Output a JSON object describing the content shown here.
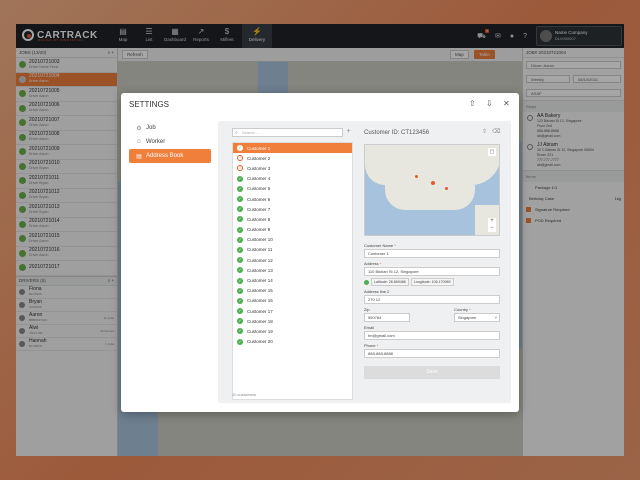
{
  "topbar": {
    "logo_text": "CARTRACK",
    "logo_sub": "DRIVEN BY INNOVATION",
    "nav": [
      {
        "label": "Map",
        "icon": "map-icon"
      },
      {
        "label": "List",
        "icon": "list-icon"
      },
      {
        "label": "Dashboard",
        "icon": "dashboard-icon"
      },
      {
        "label": "Reports",
        "icon": "reports-icon"
      },
      {
        "label": "Mifleet",
        "icon": "dollar-icon"
      },
      {
        "label": "Delivery",
        "icon": "bolt-icon"
      }
    ],
    "notification_count": "9",
    "company_name": "Name Company",
    "company_user": "DLV000007"
  },
  "sidebar": {
    "jobs_header": "JOBS (13/20)",
    "jobs": [
      {
        "id": "20210721003",
        "driver": "Driver Name Fiona",
        "state": "done"
      },
      {
        "id": "20210721004",
        "driver": "Driver Aaron",
        "state": "active"
      },
      {
        "id": "20210721005",
        "driver": "Driver Aaron",
        "state": "done"
      },
      {
        "id": "20210721006",
        "driver": "Driver Aaron",
        "state": "done"
      },
      {
        "id": "20210721007",
        "driver": "Driver Aaron",
        "state": "done"
      },
      {
        "id": "20210721008",
        "driver": "Driver Aaron",
        "state": "done"
      },
      {
        "id": "20210721009",
        "driver": "Driver Aaron",
        "state": "done"
      },
      {
        "id": "20210721010",
        "driver": "Driver Bryan",
        "state": "done"
      },
      {
        "id": "20210721011",
        "driver": "Driver Bryan",
        "state": "done"
      },
      {
        "id": "20210721012",
        "driver": "Driver Bryan",
        "state": "done"
      },
      {
        "id": "20210721013",
        "driver": "Driver Bryan",
        "state": "done"
      },
      {
        "id": "20210721014",
        "driver": "Driver Aaron",
        "state": "done"
      },
      {
        "id": "20210721015",
        "driver": "Driver Aaron",
        "state": "done"
      },
      {
        "id": "20210721016",
        "driver": "Driver Aaron",
        "state": "done"
      },
      {
        "id": "20210721017",
        "driver": "",
        "state": "done"
      }
    ],
    "drivers_header": "DRIVERS (5)",
    "drivers": [
      {
        "name": "Fiona",
        "code": "BLN5936",
        "right": ""
      },
      {
        "name": "Bryan",
        "code": "JDN5436",
        "right": ""
      },
      {
        "name": "Aaron",
        "code": "BBB0037300",
        "right": "11 Jobs"
      },
      {
        "name": "Alwi",
        "code": "JWG7189",
        "right": "25 Routes"
      },
      {
        "name": "Hannah",
        "code": "BLN5936",
        "right": "1 Jobs"
      }
    ]
  },
  "map_toolbar": {
    "refresh": "Refresh",
    "map": "Map",
    "table": "Table"
  },
  "right_panel": {
    "header": "JOB# 20210721004",
    "driver_select": "Driver: Aaron",
    "freq_select": "Weekly",
    "date_select": "08/10/2021",
    "time_select": "ASAP",
    "stops_label": "Stops",
    "stops": [
      {
        "name": "AA Bakery",
        "lines": [
          "123 Bishan St 12, Singapore",
          "Floor 2nd",
          "888-888-8888",
          "ab@gmail.com"
        ]
      },
      {
        "name": "JJ Abram",
        "lines": [
          "30 C Bishan St 12, Singapore 55694",
          "Room 221",
          "777-777-7777",
          "ab@gmail.com"
        ]
      }
    ],
    "items_label": "Items",
    "package_label": "Package 1/1",
    "item_name": "Birthday Cake",
    "item_qty": "1kg",
    "sig_label": "Signature Required",
    "pod_label": "POD Required"
  },
  "modal": {
    "title": "SETTINGS",
    "nav": [
      {
        "label": "Job",
        "icon": "gear-icon",
        "active": false
      },
      {
        "label": "Worker",
        "icon": "worker-icon",
        "active": false
      },
      {
        "label": "Address Book",
        "icon": "address-book-icon",
        "active": true
      }
    ],
    "search_placeholder": "Search...",
    "customers": [
      {
        "label": "Customer 1",
        "status": "ok"
      },
      {
        "label": "Customer 2",
        "status": "alert"
      },
      {
        "label": "Customer 3",
        "status": "alert"
      },
      {
        "label": "Customer 4",
        "status": "ok"
      },
      {
        "label": "Customer 5",
        "status": "ok"
      },
      {
        "label": "Customer 6",
        "status": "ok"
      },
      {
        "label": "Customer 7",
        "status": "ok"
      },
      {
        "label": "Customer 8",
        "status": "ok"
      },
      {
        "label": "Customer 9",
        "status": "ok"
      },
      {
        "label": "Customer 10",
        "status": "ok"
      },
      {
        "label": "Customer 11",
        "status": "ok"
      },
      {
        "label": "Customer 12",
        "status": "ok"
      },
      {
        "label": "Customer 13",
        "status": "ok"
      },
      {
        "label": "Customer 14",
        "status": "ok"
      },
      {
        "label": "Customer 15",
        "status": "ok"
      },
      {
        "label": "Customer 16",
        "status": "ok"
      },
      {
        "label": "Customer 17",
        "status": "ok"
      },
      {
        "label": "Customer 18",
        "status": "ok"
      },
      {
        "label": "Customer 19",
        "status": "ok"
      },
      {
        "label": "Customer 20",
        "status": "ok"
      }
    ],
    "count_text": "20 customers",
    "customer_id": "Customer ID: CT123456",
    "form": {
      "name_label": "Customer Name",
      "name_value": "Customer 1",
      "address_label": "Address",
      "address_value": "110 Bishan St 12, Singapore",
      "latitude": "Latitude: 26.669486",
      "longitude": "Longitude: 106.170989",
      "address2_label": "Address line 2",
      "address2_value": "270 12",
      "zip_label": "Zip",
      "zip_value": "550784",
      "country_label": "Country",
      "country_value": "Singapore",
      "email_label": "Email",
      "email_value": "hn@gmail.com",
      "phone_label": "Phone",
      "phone_value": "888-888-8888",
      "save_label": "Save"
    }
  },
  "colors": {
    "accent": "#f07f3c",
    "topbar": "#1f2327",
    "ok": "#4caf50",
    "alert": "#e25b2a"
  }
}
